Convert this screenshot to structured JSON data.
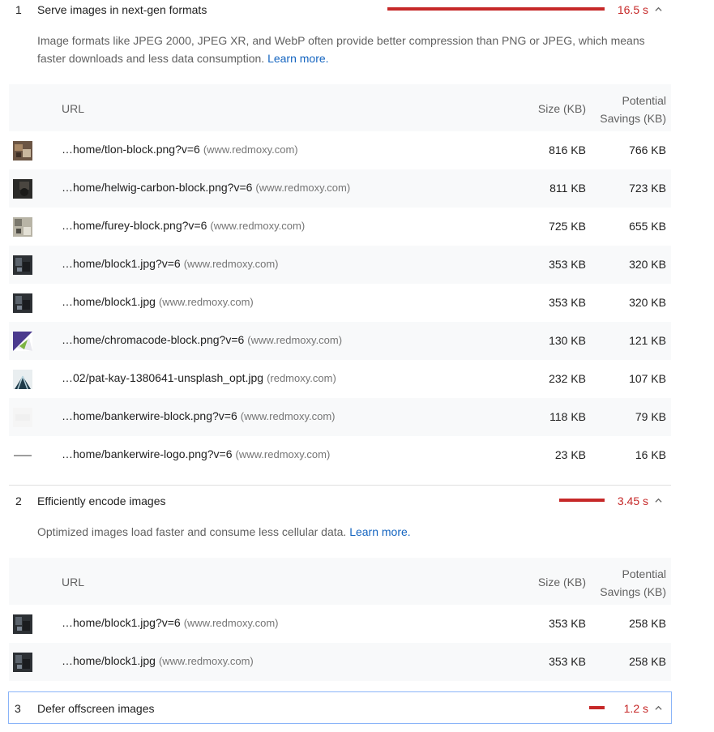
{
  "audit1": {
    "number": "1",
    "title": "Serve images in next-gen formats",
    "time": "16.5 s",
    "description": "Image formats like JPEG 2000, JPEG XR, and WebP often provide better compression than PNG or JPEG, which means faster downloads and less data consumption.",
    "learn_more": "Learn more.",
    "columns": {
      "url": "URL",
      "size": "Size (KB)",
      "savings_line1": "Potential",
      "savings_line2": "Savings (KB)"
    },
    "rows": [
      {
        "thumb": "tlon-block-thumbnail",
        "url": "…home/tlon-block.png?v=6",
        "host": "(www.redmoxy.com)",
        "size": "816 KB",
        "savings": "766 KB"
      },
      {
        "thumb": "helwig-carbon-thumbnail",
        "url": "…home/helwig-carbon-block.png?v=6",
        "host": "(www.redmoxy.com)",
        "size": "811 KB",
        "savings": "723 KB"
      },
      {
        "thumb": "furey-block-thumbnail",
        "url": "…home/furey-block.png?v=6",
        "host": "(www.redmoxy.com)",
        "size": "725 KB",
        "savings": "655 KB"
      },
      {
        "thumb": "block1-thumbnail",
        "url": "…home/block1.jpg?v=6",
        "host": "(www.redmoxy.com)",
        "size": "353 KB",
        "savings": "320 KB"
      },
      {
        "thumb": "block1-thumbnail",
        "url": "…home/block1.jpg",
        "host": "(www.redmoxy.com)",
        "size": "353 KB",
        "savings": "320 KB"
      },
      {
        "thumb": "chromacode-thumbnail",
        "url": "…home/chromacode-block.png?v=6",
        "host": "(www.redmoxy.com)",
        "size": "130 KB",
        "savings": "121 KB"
      },
      {
        "thumb": "pat-kay-thumbnail",
        "url": "…02/pat-kay-1380641-unsplash_opt.jpg",
        "host": "(redmoxy.com)",
        "size": "232 KB",
        "savings": "107 KB"
      },
      {
        "thumb": "bankerwire-block-thumbnail",
        "url": "…home/bankerwire-block.png?v=6",
        "host": "(www.redmoxy.com)",
        "size": "118 KB",
        "savings": "79 KB"
      },
      {
        "thumb": "bankerwire-logo-thumbnail",
        "url": "…home/bankerwire-logo.png?v=6",
        "host": "(www.redmoxy.com)",
        "size": "23 KB",
        "savings": "16 KB"
      }
    ]
  },
  "audit2": {
    "number": "2",
    "title": "Efficiently encode images",
    "time": "3.45 s",
    "description": "Optimized images load faster and consume less cellular data.",
    "learn_more": "Learn more.",
    "columns": {
      "url": "URL",
      "size": "Size (KB)",
      "savings_line1": "Potential",
      "savings_line2": "Savings (KB)"
    },
    "rows": [
      {
        "thumb": "block1-thumbnail",
        "url": "…home/block1.jpg?v=6",
        "host": "(www.redmoxy.com)",
        "size": "353 KB",
        "savings": "258 KB"
      },
      {
        "thumb": "block1-thumbnail",
        "url": "…home/block1.jpg",
        "host": "(www.redmoxy.com)",
        "size": "353 KB",
        "savings": "258 KB"
      }
    ]
  },
  "audit3": {
    "number": "3",
    "title": "Defer offscreen images",
    "time": "1.2 s"
  },
  "colors": {
    "fail": "#c62828",
    "link": "#1565c0",
    "focus_border": "#8ab4f8"
  }
}
